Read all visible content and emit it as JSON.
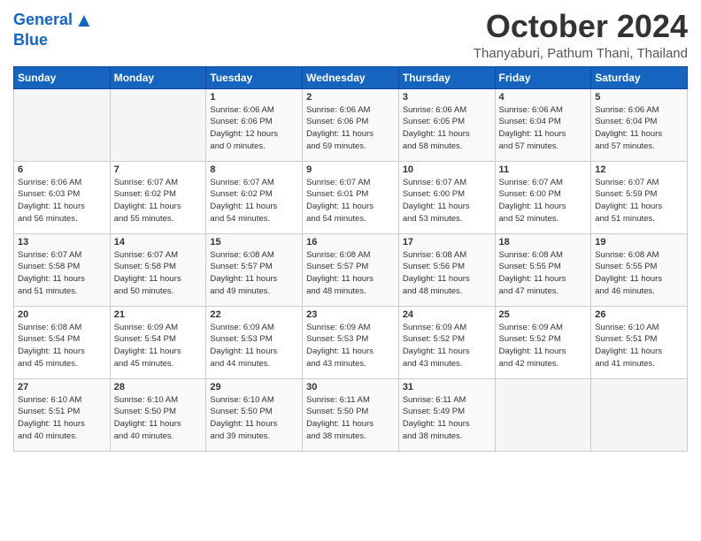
{
  "header": {
    "logo_line1": "General",
    "logo_line2": "Blue",
    "month": "October 2024",
    "location": "Thanyaburi, Pathum Thani, Thailand"
  },
  "days_of_week": [
    "Sunday",
    "Monday",
    "Tuesday",
    "Wednesday",
    "Thursday",
    "Friday",
    "Saturday"
  ],
  "weeks": [
    [
      {
        "day": "",
        "info": ""
      },
      {
        "day": "",
        "info": ""
      },
      {
        "day": "1",
        "info": "Sunrise: 6:06 AM\nSunset: 6:06 PM\nDaylight: 12 hours\nand 0 minutes."
      },
      {
        "day": "2",
        "info": "Sunrise: 6:06 AM\nSunset: 6:06 PM\nDaylight: 11 hours\nand 59 minutes."
      },
      {
        "day": "3",
        "info": "Sunrise: 6:06 AM\nSunset: 6:05 PM\nDaylight: 11 hours\nand 58 minutes."
      },
      {
        "day": "4",
        "info": "Sunrise: 6:06 AM\nSunset: 6:04 PM\nDaylight: 11 hours\nand 57 minutes."
      },
      {
        "day": "5",
        "info": "Sunrise: 6:06 AM\nSunset: 6:04 PM\nDaylight: 11 hours\nand 57 minutes."
      }
    ],
    [
      {
        "day": "6",
        "info": "Sunrise: 6:06 AM\nSunset: 6:03 PM\nDaylight: 11 hours\nand 56 minutes."
      },
      {
        "day": "7",
        "info": "Sunrise: 6:07 AM\nSunset: 6:02 PM\nDaylight: 11 hours\nand 55 minutes."
      },
      {
        "day": "8",
        "info": "Sunrise: 6:07 AM\nSunset: 6:02 PM\nDaylight: 11 hours\nand 54 minutes."
      },
      {
        "day": "9",
        "info": "Sunrise: 6:07 AM\nSunset: 6:01 PM\nDaylight: 11 hours\nand 54 minutes."
      },
      {
        "day": "10",
        "info": "Sunrise: 6:07 AM\nSunset: 6:00 PM\nDaylight: 11 hours\nand 53 minutes."
      },
      {
        "day": "11",
        "info": "Sunrise: 6:07 AM\nSunset: 6:00 PM\nDaylight: 11 hours\nand 52 minutes."
      },
      {
        "day": "12",
        "info": "Sunrise: 6:07 AM\nSunset: 5:59 PM\nDaylight: 11 hours\nand 51 minutes."
      }
    ],
    [
      {
        "day": "13",
        "info": "Sunrise: 6:07 AM\nSunset: 5:58 PM\nDaylight: 11 hours\nand 51 minutes."
      },
      {
        "day": "14",
        "info": "Sunrise: 6:07 AM\nSunset: 5:58 PM\nDaylight: 11 hours\nand 50 minutes."
      },
      {
        "day": "15",
        "info": "Sunrise: 6:08 AM\nSunset: 5:57 PM\nDaylight: 11 hours\nand 49 minutes."
      },
      {
        "day": "16",
        "info": "Sunrise: 6:08 AM\nSunset: 5:57 PM\nDaylight: 11 hours\nand 48 minutes."
      },
      {
        "day": "17",
        "info": "Sunrise: 6:08 AM\nSunset: 5:56 PM\nDaylight: 11 hours\nand 48 minutes."
      },
      {
        "day": "18",
        "info": "Sunrise: 6:08 AM\nSunset: 5:55 PM\nDaylight: 11 hours\nand 47 minutes."
      },
      {
        "day": "19",
        "info": "Sunrise: 6:08 AM\nSunset: 5:55 PM\nDaylight: 11 hours\nand 46 minutes."
      }
    ],
    [
      {
        "day": "20",
        "info": "Sunrise: 6:08 AM\nSunset: 5:54 PM\nDaylight: 11 hours\nand 45 minutes."
      },
      {
        "day": "21",
        "info": "Sunrise: 6:09 AM\nSunset: 5:54 PM\nDaylight: 11 hours\nand 45 minutes."
      },
      {
        "day": "22",
        "info": "Sunrise: 6:09 AM\nSunset: 5:53 PM\nDaylight: 11 hours\nand 44 minutes."
      },
      {
        "day": "23",
        "info": "Sunrise: 6:09 AM\nSunset: 5:53 PM\nDaylight: 11 hours\nand 43 minutes."
      },
      {
        "day": "24",
        "info": "Sunrise: 6:09 AM\nSunset: 5:52 PM\nDaylight: 11 hours\nand 43 minutes."
      },
      {
        "day": "25",
        "info": "Sunrise: 6:09 AM\nSunset: 5:52 PM\nDaylight: 11 hours\nand 42 minutes."
      },
      {
        "day": "26",
        "info": "Sunrise: 6:10 AM\nSunset: 5:51 PM\nDaylight: 11 hours\nand 41 minutes."
      }
    ],
    [
      {
        "day": "27",
        "info": "Sunrise: 6:10 AM\nSunset: 5:51 PM\nDaylight: 11 hours\nand 40 minutes."
      },
      {
        "day": "28",
        "info": "Sunrise: 6:10 AM\nSunset: 5:50 PM\nDaylight: 11 hours\nand 40 minutes."
      },
      {
        "day": "29",
        "info": "Sunrise: 6:10 AM\nSunset: 5:50 PM\nDaylight: 11 hours\nand 39 minutes."
      },
      {
        "day": "30",
        "info": "Sunrise: 6:11 AM\nSunset: 5:50 PM\nDaylight: 11 hours\nand 38 minutes."
      },
      {
        "day": "31",
        "info": "Sunrise: 6:11 AM\nSunset: 5:49 PM\nDaylight: 11 hours\nand 38 minutes."
      },
      {
        "day": "",
        "info": ""
      },
      {
        "day": "",
        "info": ""
      }
    ]
  ]
}
